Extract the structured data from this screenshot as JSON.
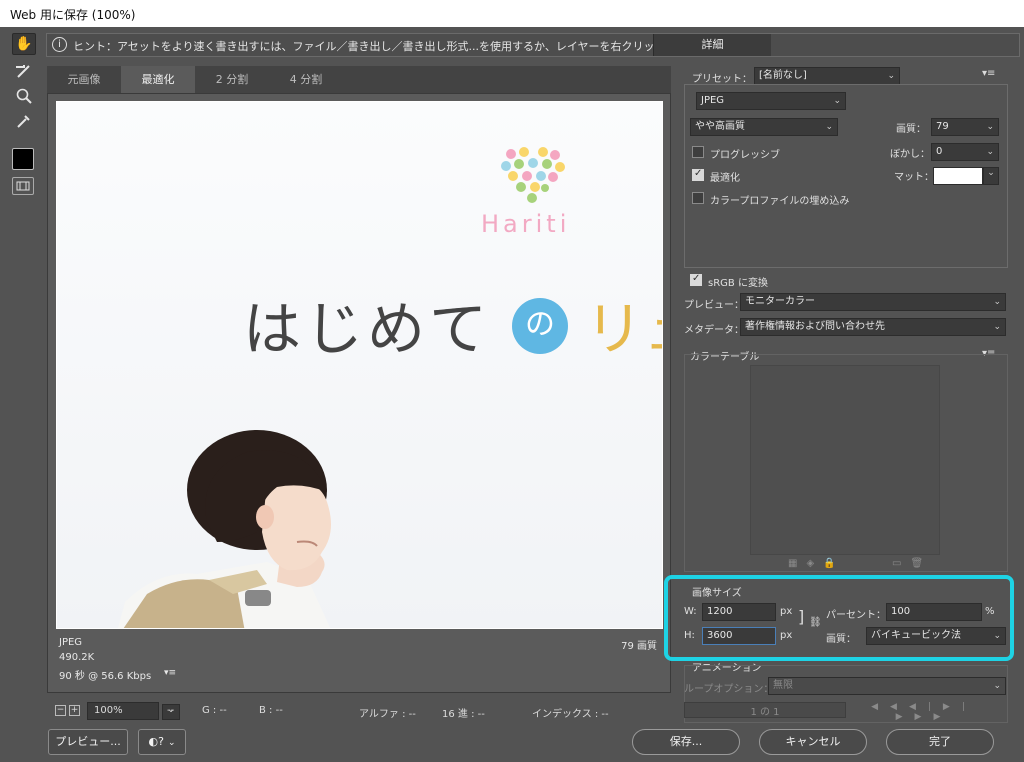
{
  "window": {
    "title": "Web 用に保存 (100%)"
  },
  "hint": {
    "text": "ヒント：アセットをより速く書き出すには、ファイル／書き出し／書き出し形式...を使用するか、レイヤーを右クリックして使用。",
    "detail_label": "詳細"
  },
  "tools": [
    "hand-tool",
    "slice-select-tool",
    "zoom-tool",
    "eyedropper-tool",
    "color-swatch",
    "toggle-slices"
  ],
  "tabs": [
    {
      "label": "元画像"
    },
    {
      "label": "最適化"
    },
    {
      "label": "2 分割"
    },
    {
      "label": "4 分割"
    }
  ],
  "active_tab": "最適化",
  "image": {
    "logo_text": "Hariti",
    "headline_text": "はじめて",
    "circle_text": "の",
    "partial_text": "リュ"
  },
  "image_info": {
    "format": "JPEG",
    "size": "490.2K",
    "time": "90 秒 @ 56.6 Kbps",
    "quality": "79 画質"
  },
  "status": {
    "zoom": "100%",
    "r": "--",
    "g_label": "G : --",
    "b_label": "B : --",
    "alpha": "アルファ : --",
    "hex": "16 進 : --",
    "index": "インデックス : --"
  },
  "bottom": {
    "preview": "プレビュー...",
    "save": "保存...",
    "cancel": "キャンセル",
    "done": "完了"
  },
  "settings": {
    "preset_label": "プリセット：",
    "preset_value": "[名前なし]",
    "format": "JPEG",
    "quality_preset": "やや高画質",
    "quality_label": "画質：",
    "quality_value": "79",
    "progressive": "プログレッシブ",
    "blur_label": "ぼかし：",
    "blur_value": "0",
    "optimized": "最適化",
    "matte_label": "マット：",
    "embed_profile": "カラープロファイルの埋め込み",
    "srgb": "sRGB に変換",
    "preview_label": "プレビュー：",
    "preview_value": "モニターカラー",
    "metadata_label": "メタデータ：",
    "metadata_value": "著作権情報および問い合わせ先",
    "color_table": "カラーテーブル",
    "image_size": "画像サイズ",
    "w_label": "W:",
    "w_value": "1200",
    "h_label": "H:",
    "h_value": "3600",
    "px": "px",
    "percent_label": "パーセント：",
    "percent_value": "100",
    "percent_unit": "%",
    "resample_label": "画質：",
    "resample_value": "バイキュービック法",
    "animation": "アニメーション",
    "loop_label": "ループオプション：",
    "loop_value": "無限",
    "frame": "1 の 1"
  },
  "colors": {
    "highlight": "#1ed3e5",
    "panel": "#535353"
  }
}
